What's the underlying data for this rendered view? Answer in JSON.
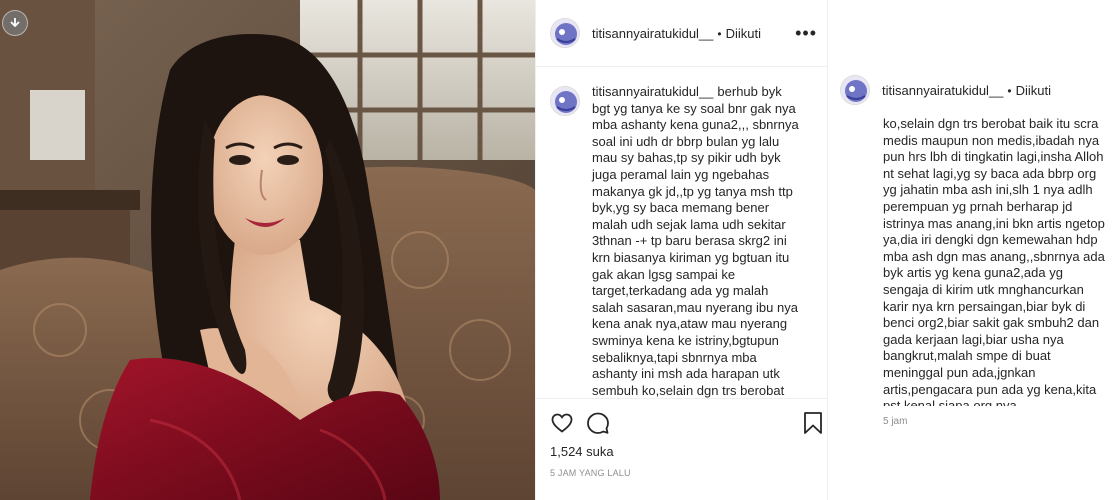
{
  "post": {
    "username": "titisannyairatukidul__",
    "separator": "•",
    "follow_status": "Diikuti",
    "caption": "berhub byk bgt yg tanya ke sy soal bnr gak nya mba ashanty kena guna2,,, sbnrnya soal ini udh dr bbrp bulan yg lalu mau sy bahas,tp sy pikir udh byk juga peramal lain yg ngebahas makanya gk jd,,tp yg tanya msh ttp byk,yg sy baca memang bener malah udh sejak lama udh sekitar 3thnan -+ tp baru berasa skrg2 ini krn biasanya kiriman yg bgtuan itu gak akan lgsg sampai ke target,terkadang ada yg malah salah sasaran,mau nyerang ibu nya kena anak nya,ataw mau nyerang swminya kena ke istriny,bgtupun sebaliknya,tapi sbnrnya mba ashanty ini msh ada harapan utk sembuh ko,selain dgn trs berobat baik itu scra medis maupun non medis,ibadah nya pun hrs lbh di tingkatin lagi,insha",
    "likes": "1,524 suka",
    "time_ago": "5 JAM YANG LALU",
    "icons": {
      "more": "more-options-icon",
      "like": "heart-icon",
      "comment": "comment-icon",
      "save": "bookmark-icon"
    }
  },
  "card": {
    "username": "titisannyairatukidul__",
    "separator": "•",
    "follow_status": "Diikuti",
    "text": "ko,selain dgn trs berobat baik itu scra medis maupun non medis,ibadah nya pun hrs lbh di tingkatin lagi,insha Alloh nt sehat lagi,yg sy baca ada bbrp org yg jahatin mba ash ini,slh 1 nya adlh perempuan yg prnah berharap jd istrinya mas anang,ini bkn artis ngetop ya,dia iri dengki dgn kemewahan hdp mba ash dgn mas anang,,sbnrnya ada byk artis yg kena guna2,ada yg sengaja di kirim utk mnghancurkan karir nya krn persaingan,biar byk di benci org2,biar sakit gak smbuh2 dan gada kerjaan lagi,biar usha nya bangkrut,malah smpe di buat meninggal pun ada,jgnkan artis,pengacara pun ada yg kena,kita pst kenal siapa org nya,,,",
    "time": "5 jam"
  },
  "colors": {
    "text": "#262626",
    "muted": "#8e8e8e",
    "border": "#efefef",
    "dress": "#8a1020"
  }
}
